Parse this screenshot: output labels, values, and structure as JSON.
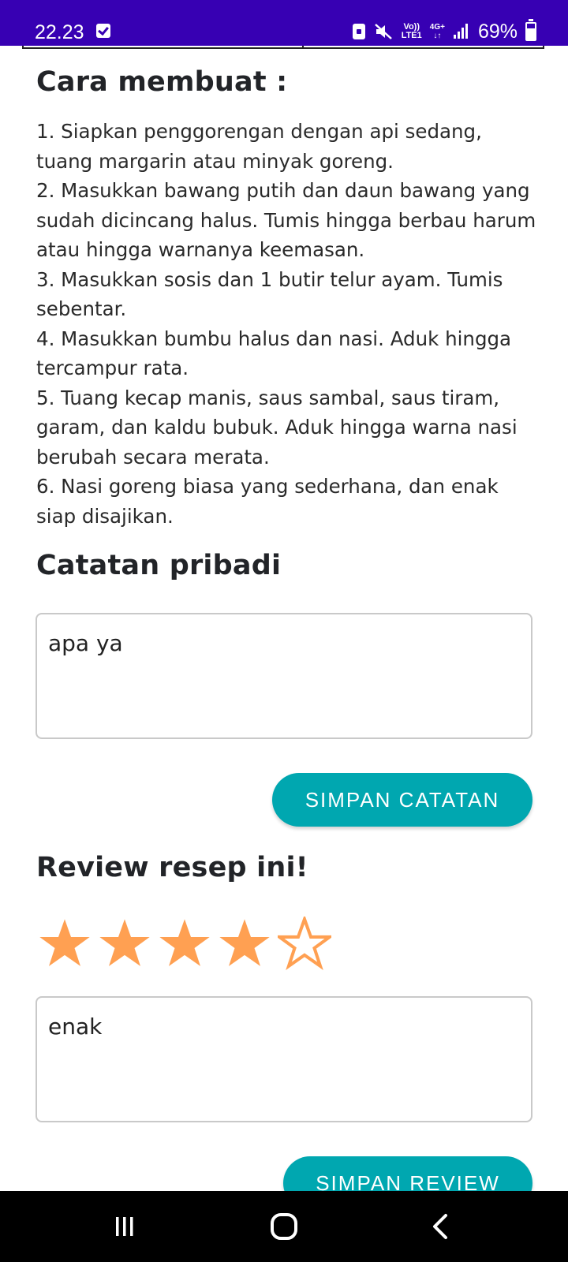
{
  "status_bar": {
    "time": "22.23",
    "volte_label_top": "Vo))",
    "volte_label_bottom": "LTE1",
    "network_label": "4G+",
    "battery_percent": "69%",
    "battery_level": 0.69,
    "background_color": "#3700b3"
  },
  "recipe": {
    "steps_heading": "Cara membuat :",
    "steps": [
      "1. Siapkan penggorengan dengan api sedang, tuang margarin atau minyak goreng.",
      "2. Masukkan bawang putih dan daun bawang yang sudah dicincang halus. Tumis hingga berbau harum atau hingga warnanya keemasan.",
      "3. Masukkan sosis dan 1 butir telur ayam. Tumis sebentar.",
      "4. Masukkan bumbu halus dan nasi. Aduk hingga tercampur rata.",
      "5. Tuang kecap manis, saus sambal, saus tiram, garam, dan kaldu bubuk. Aduk hingga warna nasi berubah secara merata.",
      "6. Nasi goreng biasa yang sederhana, dan enak siap disajikan."
    ]
  },
  "notes": {
    "heading": "Catatan pribadi",
    "value": "apa ya",
    "save_label": "SIMPAN CATATAN"
  },
  "review": {
    "heading": "Review resep ini!",
    "rating": 4,
    "max_rating": 5,
    "value": "enak",
    "save_label": "SIMPAN REVIEW"
  },
  "colors": {
    "accent": "#00a7b0",
    "star": "#ffa052",
    "text": "#222222"
  },
  "nav_bar": {
    "icons": [
      "recents-icon",
      "home-icon",
      "back-icon"
    ]
  }
}
